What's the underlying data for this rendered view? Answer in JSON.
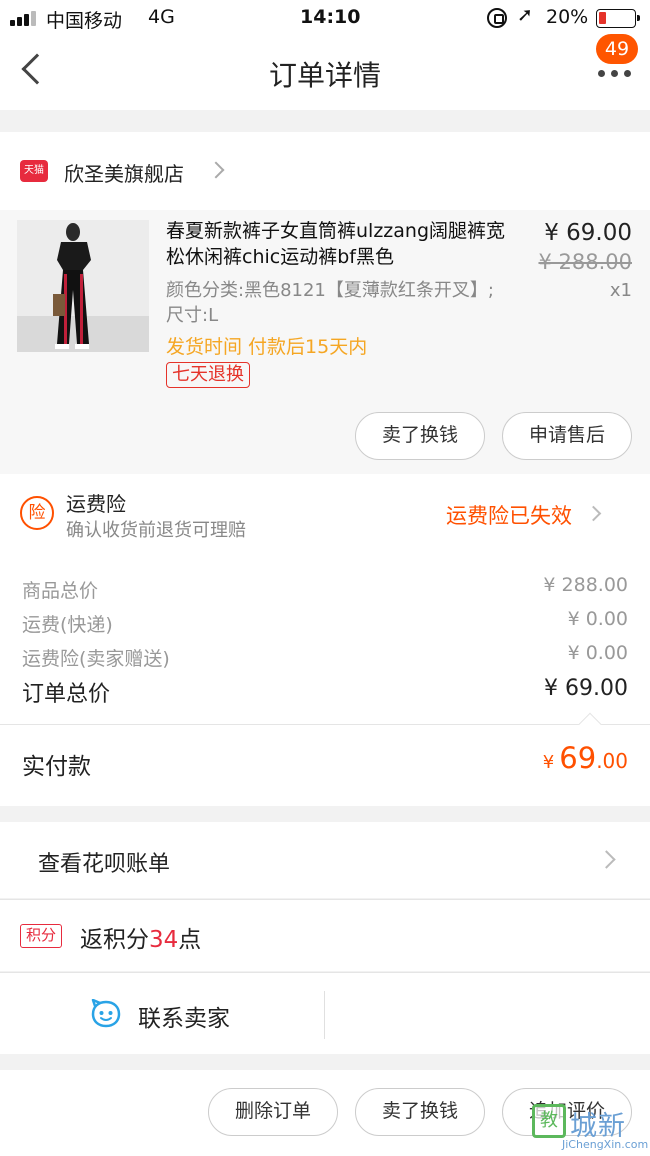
{
  "status_bar": {
    "carrier": "中国移动",
    "network": "4G",
    "time": "14:10",
    "battery": "20%"
  },
  "nav": {
    "title": "订单详情",
    "badge_count": "49"
  },
  "shop": {
    "icon_text": "天猫",
    "name": "欣圣美旗舰店"
  },
  "product": {
    "title": "春夏新款裤子女直筒裤ulzzang阔腿裤宽松休闲裤chic运动裤bf黑色",
    "price": "¥ 69.00",
    "original_price": "¥ 288.00",
    "quantity": "x1",
    "sku": "颜色分类:黑色8121【夏薄款红条开叉】;尺寸:L",
    "shipping_time": "发货时间 付款后15天内",
    "return_tag": "七天退换",
    "actions": [
      "卖了换钱",
      "申请售后"
    ]
  },
  "insurance": {
    "icon_text": "险",
    "title": "运费险",
    "subtitle": "确认收货前退货可理赔",
    "status": "运费险已失效"
  },
  "summary": {
    "rows": [
      {
        "label": "商品总价",
        "value": "¥ 288.00"
      },
      {
        "label": "运费(快递)",
        "value": "¥ 0.00"
      },
      {
        "label": "运费险(卖家赠送)",
        "value": "¥ 0.00"
      }
    ],
    "total_label": "订单总价",
    "total_value": "¥ 69.00",
    "paid_label": "实付款",
    "paid_currency": "¥",
    "paid_int": "69",
    "paid_dec": ".00"
  },
  "huabei": {
    "label": "查看花呗账单"
  },
  "points": {
    "badge": "积分",
    "prefix": "返积分",
    "amount": "34",
    "suffix": "点"
  },
  "contact": {
    "label": "联系卖家"
  },
  "bottom_actions": [
    "删除订单",
    "卖了换钱",
    "追加评价"
  ],
  "watermark": {
    "icon_text": "教",
    "text": "城新",
    "sub": "JiChengXin.com"
  },
  "colors": {
    "accent": "#ff5000",
    "tmall_red": "#e72b3e",
    "orange_text": "#f5a623"
  }
}
